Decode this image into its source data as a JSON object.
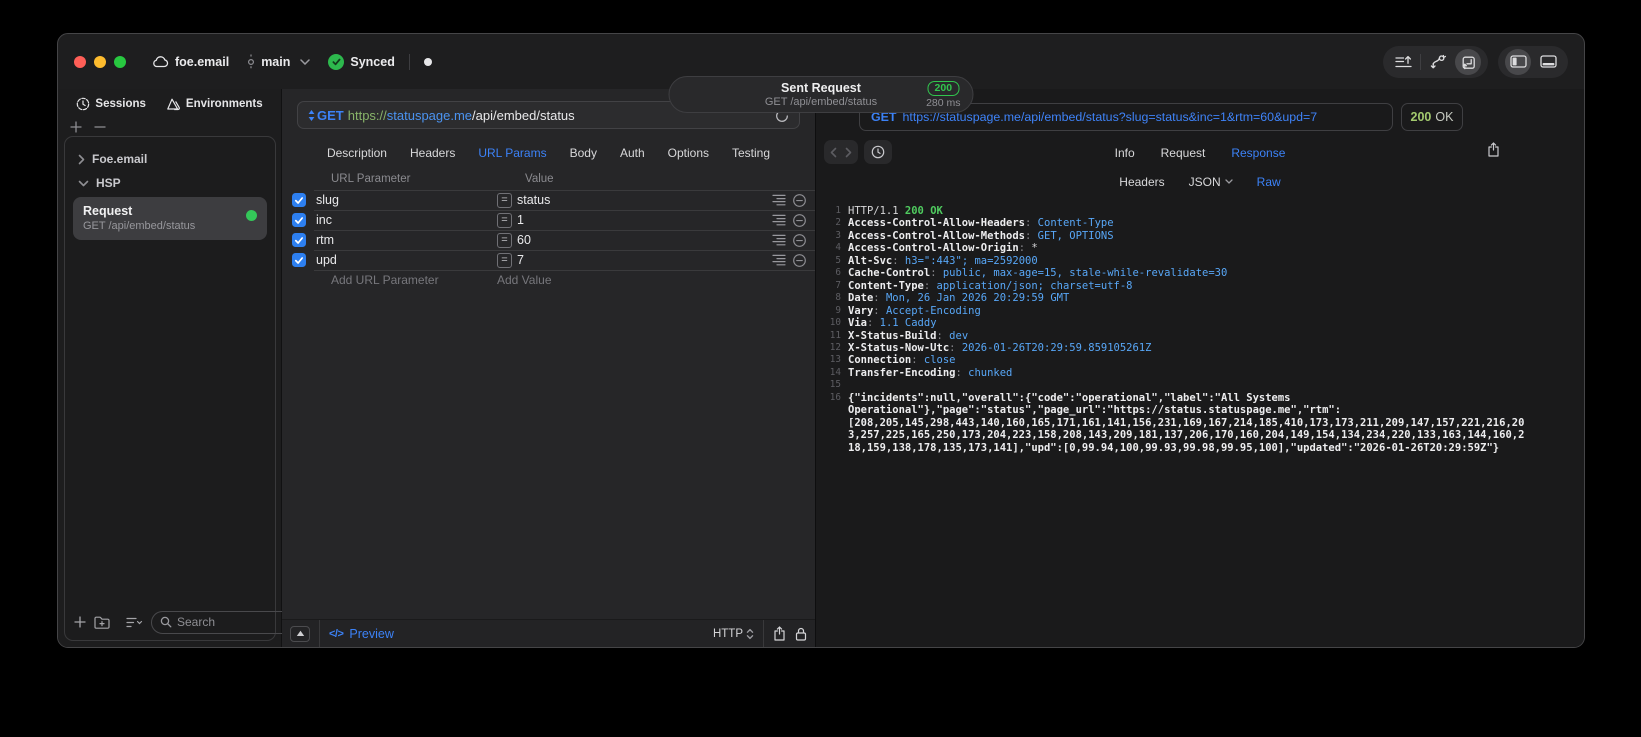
{
  "titlebar": {
    "project": "foe.email",
    "branch": "main",
    "sync_label": "Synced",
    "center": {
      "title": "Sent Request",
      "subtitle": "GET /api/embed/status",
      "status_code": "200",
      "duration": "280 ms"
    }
  },
  "sidebar": {
    "tabs": [
      {
        "label": "Sessions",
        "icon": "clock-icon"
      },
      {
        "label": "Environments",
        "icon": "environments-icon"
      }
    ],
    "groups": [
      {
        "label": "Foe.email",
        "state": "collapsed"
      },
      {
        "label": "HSP",
        "state": "expanded"
      }
    ],
    "selected_request": {
      "title": "Request",
      "subtitle": "GET /api/embed/status",
      "status_dot_color": "#34c759"
    },
    "search_placeholder": "Search"
  },
  "request_panel": {
    "method": "GET",
    "url": {
      "scheme": "https://",
      "host": "statuspage.me",
      "path": "/api/embed/status"
    },
    "tabs": [
      "Description",
      "Headers",
      "URL Params",
      "Body",
      "Auth",
      "Options",
      "Testing"
    ],
    "active_tab": "URL Params",
    "params": {
      "col_name": "URL Parameter",
      "col_value": "Value",
      "rows": [
        {
          "name": "slug",
          "value": "status",
          "checked": true
        },
        {
          "name": "inc",
          "value": "1",
          "checked": true
        },
        {
          "name": "rtm",
          "value": "60",
          "checked": true
        },
        {
          "name": "upd",
          "value": "7",
          "checked": true
        }
      ],
      "add_name_placeholder": "Add URL Parameter",
      "add_value_placeholder": "Add Value"
    },
    "footer": {
      "preview_label": "Preview",
      "protocol_label": "HTTP"
    }
  },
  "response_panel": {
    "request_line": {
      "method": "GET",
      "url": "https://statuspage.me/api/embed/status?slug=status&inc=1&rtm=60&upd=7"
    },
    "status": {
      "code": "200",
      "text": "OK"
    },
    "tabs": [
      "Info",
      "Request",
      "Response"
    ],
    "active_tab": "Response",
    "view_tabs": [
      "Headers",
      "JSON",
      "Raw"
    ],
    "active_view_tab": "Raw",
    "code": {
      "lines": [
        {
          "n": "1",
          "parts": [
            {
              "t": "HTTP/1.1 ",
              "c": "plain"
            },
            {
              "t": "200 OK",
              "c": "green"
            }
          ]
        },
        {
          "n": "2",
          "parts": [
            {
              "t": "Access-Control-Allow-Headers",
              "c": "name"
            },
            {
              "t": ": ",
              "c": "sep"
            },
            {
              "t": "Content-Type",
              "c": "val"
            }
          ]
        },
        {
          "n": "3",
          "parts": [
            {
              "t": "Access-Control-Allow-Methods",
              "c": "name"
            },
            {
              "t": ": ",
              "c": "sep"
            },
            {
              "t": "GET, OPTIONS",
              "c": "val"
            }
          ]
        },
        {
          "n": "4",
          "parts": [
            {
              "t": "Access-Control-Allow-Origin",
              "c": "name"
            },
            {
              "t": ": ",
              "c": "sep"
            },
            {
              "t": "*",
              "c": "plain"
            }
          ]
        },
        {
          "n": "5",
          "parts": [
            {
              "t": "Alt-Svc",
              "c": "name"
            },
            {
              "t": ": ",
              "c": "sep"
            },
            {
              "t": "h3=\":443\"; ma=2592000",
              "c": "val"
            }
          ]
        },
        {
          "n": "6",
          "parts": [
            {
              "t": "Cache-Control",
              "c": "name"
            },
            {
              "t": ": ",
              "c": "sep"
            },
            {
              "t": "public, max-age=15, stale-while-revalidate=30",
              "c": "val"
            }
          ]
        },
        {
          "n": "7",
          "parts": [
            {
              "t": "Content-Type",
              "c": "name"
            },
            {
              "t": ": ",
              "c": "sep"
            },
            {
              "t": "application/json; charset=utf-8",
              "c": "val"
            }
          ]
        },
        {
          "n": "8",
          "parts": [
            {
              "t": "Date",
              "c": "name"
            },
            {
              "t": ": ",
              "c": "sep"
            },
            {
              "t": "Mon, 26 Jan 2026 20:29:59 GMT",
              "c": "val"
            }
          ]
        },
        {
          "n": "9",
          "parts": [
            {
              "t": "Vary",
              "c": "name"
            },
            {
              "t": ": ",
              "c": "sep"
            },
            {
              "t": "Accept-Encoding",
              "c": "val"
            }
          ]
        },
        {
          "n": "10",
          "parts": [
            {
              "t": "Via",
              "c": "name"
            },
            {
              "t": ": ",
              "c": "sep"
            },
            {
              "t": "1.1 Caddy",
              "c": "val"
            }
          ]
        },
        {
          "n": "11",
          "parts": [
            {
              "t": "X-Status-Build",
              "c": "name"
            },
            {
              "t": ": ",
              "c": "sep"
            },
            {
              "t": "dev",
              "c": "val"
            }
          ]
        },
        {
          "n": "12",
          "parts": [
            {
              "t": "X-Status-Now-Utc",
              "c": "name"
            },
            {
              "t": ": ",
              "c": "sep"
            },
            {
              "t": "2026-01-26T20:29:59.859105261Z",
              "c": "val"
            }
          ]
        },
        {
          "n": "13",
          "parts": [
            {
              "t": "Connection",
              "c": "name"
            },
            {
              "t": ": ",
              "c": "sep"
            },
            {
              "t": "close",
              "c": "val"
            }
          ]
        },
        {
          "n": "14",
          "parts": [
            {
              "t": "Transfer-Encoding",
              "c": "name"
            },
            {
              "t": ": ",
              "c": "sep"
            },
            {
              "t": "chunked",
              "c": "val"
            }
          ]
        },
        {
          "n": "15",
          "parts": []
        },
        {
          "n": "16",
          "parts": [
            {
              "t": "{\"incidents\":null,\"overall\":{\"code\":\"operational\",\"label\":\"All Systems Operational\"},\"page\":\"status\",\"page_url\":\"https://status.statuspage.me\",\"rtm\":[208,205,145,298,443,140,160,165,171,161,141,156,231,169,167,214,185,410,173,173,211,209,147,157,221,216,203,257,225,165,250,173,204,223,158,208,143,209,181,137,206,170,160,204,149,154,134,234,220,133,163,144,160,218,159,138,178,135,173,141],\"upd\":[0,99.94,100,99.93,99.98,99.95,100],\"updated\":\"2026-01-26T20:29:59Z\"}",
              "c": "body"
            }
          ]
        }
      ]
    }
  },
  "colors": {
    "accent_blue": "#3c82f7",
    "sync_green": "#2db84d",
    "status_green": "#34c759",
    "badge_green": "#31c54e",
    "checkbox_blue": "#2d7ff0"
  }
}
